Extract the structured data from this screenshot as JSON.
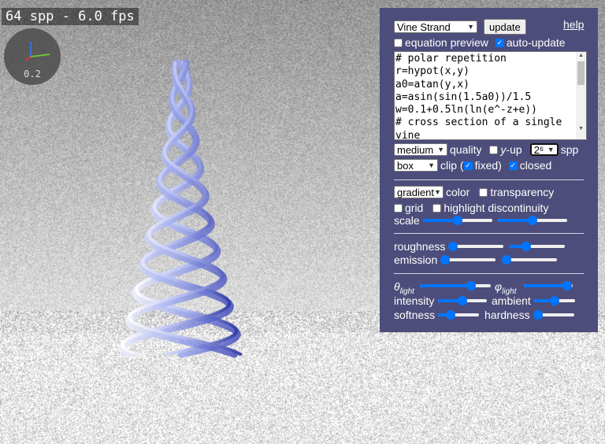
{
  "status": {
    "fps": "64 spp - 6.0 fps"
  },
  "axes_gizmo": {
    "scale": "0.2",
    "icon": "axes-gizmo-icon"
  },
  "panel": {
    "preset_select": "Vine Strand",
    "update_label": "update",
    "help_label": "help",
    "equation_preview": {
      "label": "equation preview",
      "checked": false
    },
    "auto_update": {
      "label": "auto-update",
      "checked": true
    },
    "code": "# polar repetition\nr=hypot(x,y)\na0=atan(y,x)\na=asin(sin(1.5a0))/1.5\nw=0.1+0.5ln(ln(e^-z+e))\n# cross section of a single\nvine",
    "quality_select": "medium",
    "quality_label": "quality",
    "y_up": {
      "label_italic": "y",
      "label": "-up",
      "checked": false
    },
    "spp_select": "2⁶",
    "spp_label": "spp",
    "clip_select": "box",
    "clip_label": "clip (",
    "fixed": {
      "label": "fixed)",
      "checked": true
    },
    "closed": {
      "label": "closed",
      "checked": true
    },
    "color_select": "gradient",
    "color_label": "color",
    "transparency": {
      "label": "transparency",
      "checked": false
    },
    "grid": {
      "label": "grid",
      "checked": false
    },
    "highlight_discontinuity": {
      "label": "highlight discontinuity",
      "checked": false
    },
    "scale_label": "scale",
    "roughness_label": "roughness",
    "emission_label": "emission",
    "theta_light": {
      "symbol": "θ",
      "sub": "light"
    },
    "phi_light": {
      "symbol": "φ",
      "sub": "light"
    },
    "intensity_label": "intensity",
    "ambient_label": "ambient",
    "softness_label": "softness",
    "hardness_label": "hardness",
    "slider_values": {
      "scale_a": 0.5,
      "scale_b": 0.5,
      "roughness_a": 0.0,
      "roughness_b": 0.3,
      "emission_a": 0.0,
      "emission_b": 0.0,
      "theta_light": 0.72,
      "phi_light": 0.88,
      "intensity": 0.5,
      "ambient": 0.5,
      "softness": 0.3,
      "hardness": 0.0
    }
  },
  "colors": {
    "panel_bg": "#4d4d7b",
    "accent": "#0075ff",
    "strand": "#6f7fe0"
  }
}
